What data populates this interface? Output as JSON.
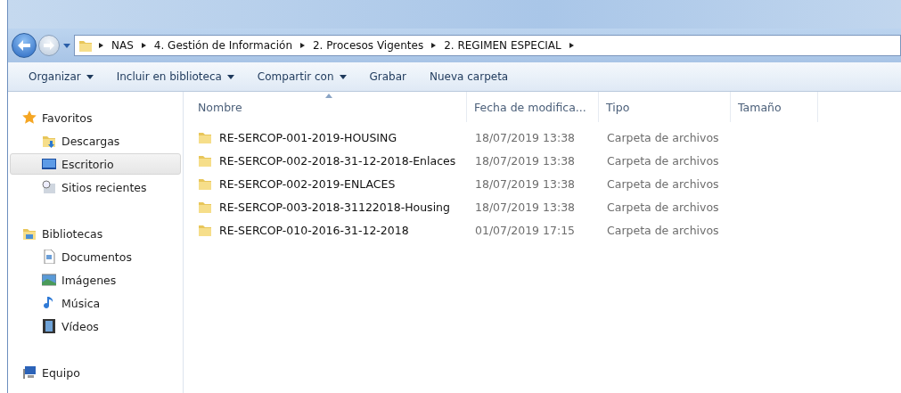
{
  "address_bar": {
    "path": [
      "NAS",
      "4. Gestión de Información",
      "2. Procesos Vigentes",
      "2. REGIMEN ESPECIAL"
    ]
  },
  "toolbar": [
    {
      "label": "Organizar",
      "dropdown": true
    },
    {
      "label": "Incluir en biblioteca",
      "dropdown": true
    },
    {
      "label": "Compartir con",
      "dropdown": true
    },
    {
      "label": "Grabar",
      "dropdown": false
    },
    {
      "label": "Nueva carpeta",
      "dropdown": false
    }
  ],
  "sidebar": {
    "groups": [
      {
        "label": "Favoritos",
        "items": [
          {
            "label": "Descargas",
            "selected": false
          },
          {
            "label": "Escritorio",
            "selected": true
          },
          {
            "label": "Sitios recientes",
            "selected": false
          }
        ]
      },
      {
        "label": "Bibliotecas",
        "items": [
          {
            "label": "Documentos",
            "selected": false
          },
          {
            "label": "Imágenes",
            "selected": false
          },
          {
            "label": "Música",
            "selected": false
          },
          {
            "label": "Vídeos",
            "selected": false
          }
        ]
      },
      {
        "label": "Equipo"
      }
    ]
  },
  "table": {
    "columns": [
      {
        "label": "Nombre",
        "sorted": true
      },
      {
        "label": "Fecha de modifica...",
        "sorted": false
      },
      {
        "label": "Tipo",
        "sorted": false
      },
      {
        "label": "Tamaño",
        "sorted": false
      }
    ],
    "rows": [
      {
        "name": "RE-SERCOP-001-2019-HOUSING",
        "date": "18/07/2019 13:38",
        "type": "Carpeta de archivos"
      },
      {
        "name": "RE-SERCOP-002-2018-31-12-2018-Enlaces",
        "date": "18/07/2019 13:38",
        "type": "Carpeta de archivos"
      },
      {
        "name": "RE-SERCOP-002-2019-ENLACES",
        "date": "18/07/2019 13:38",
        "type": "Carpeta de archivos"
      },
      {
        "name": "RE-SERCOP-003-2018-31122018-Housing",
        "date": "18/07/2019 13:38",
        "type": "Carpeta de archivos"
      },
      {
        "name": "RE-SERCOP-010-2016-31-12-2018",
        "date": "01/07/2019 17:15",
        "type": "Carpeta de archivos"
      }
    ]
  }
}
